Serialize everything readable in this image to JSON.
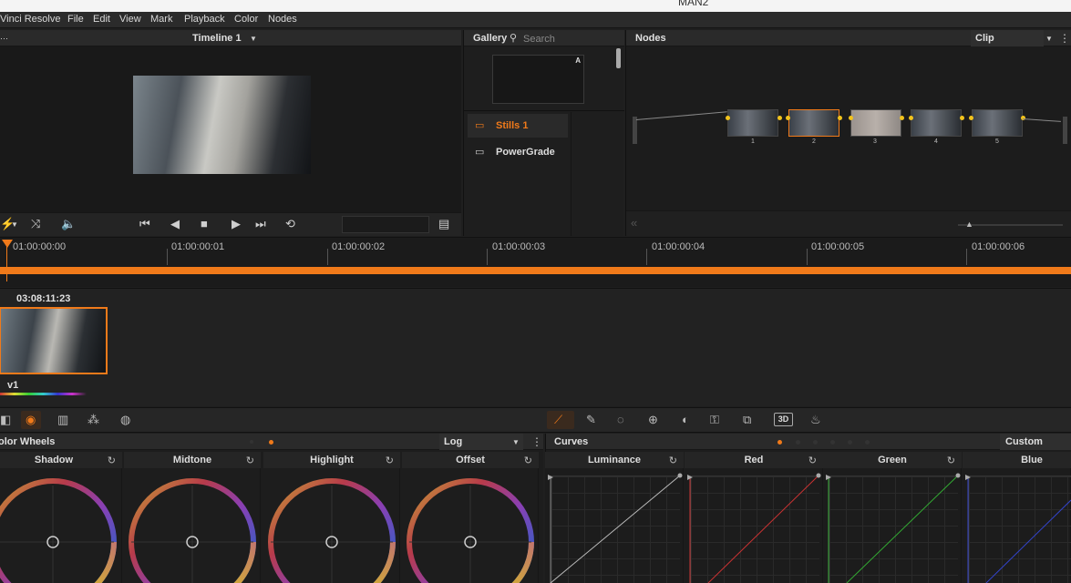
{
  "window": {
    "title": "MAN2"
  },
  "menu": [
    "Vinci Resolve",
    "File",
    "Edit",
    "View",
    "Mark",
    "Playback",
    "Color",
    "Nodes"
  ],
  "viewer": {
    "timeline_label": "Timeline 1"
  },
  "gallery": {
    "title": "Gallery",
    "search_placeholder": "Search",
    "thumb_badge": "A",
    "albums": [
      "Stills 1",
      "PowerGrade"
    ]
  },
  "nodes": {
    "title": "Nodes",
    "mode": "Clip",
    "node_numbers": [
      "1",
      "2",
      "3",
      "4",
      "5"
    ]
  },
  "timeline": {
    "ticks": [
      "01:00:00:00",
      "01:00:00:01",
      "01:00:00:02",
      "01:00:00:03",
      "01:00:00:04",
      "01:00:00:05",
      "01:00:00:06"
    ]
  },
  "clip": {
    "timecode": "03:08:11:23",
    "track": "v1"
  },
  "color_wheels": {
    "title": "olor Wheels",
    "mode": "Log",
    "wheels": [
      "Shadow",
      "Midtone",
      "Highlight",
      "Offset"
    ]
  },
  "curves": {
    "title": "Curves",
    "mode": "Custom",
    "channels": [
      "Luminance",
      "Red",
      "Green",
      "Blue"
    ]
  },
  "colors": {
    "accent": "#f07a1a",
    "node_dot": "#f2c31c"
  }
}
